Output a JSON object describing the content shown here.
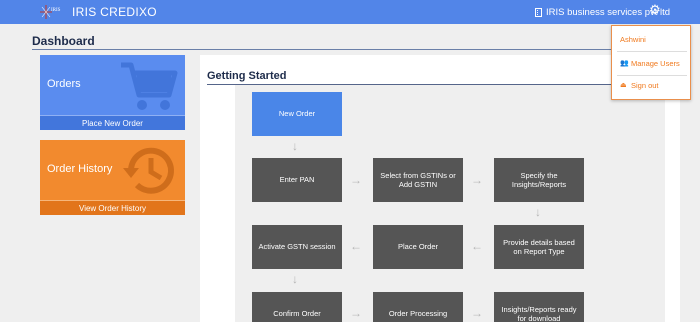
{
  "app": {
    "brand_logo_text": "IRIS",
    "brand_title": "IRIS CREDIXO",
    "company": "IRIS business services pvt ltd"
  },
  "icons": {
    "company": "building-icon",
    "settings": "gear-icon",
    "manage_users": "users-icon",
    "sign_out": "sign-out-icon",
    "orders": "cart-icon",
    "history": "history-icon"
  },
  "page": {
    "title": "Dashboard"
  },
  "tiles": {
    "orders": {
      "label": "Orders",
      "footer": "Place New Order"
    },
    "history": {
      "label": "Order History",
      "footer": "View Order History"
    }
  },
  "getting_started": {
    "title": "Getting Started",
    "steps": {
      "new_order": "New Order",
      "enter_pan": "Enter PAN",
      "select_gstin": "Select from GSTINs or Add GSTIN",
      "specify_insights": "Specify the Insights/Reports",
      "provide_details": "Provide details based on Report Type",
      "place_order": "Place Order",
      "activate_gstn": "Activate GSTN session",
      "confirm_order": "Confirm Order",
      "order_processing": "Order Processing",
      "insights_ready": "Insights/Reports ready for download"
    }
  },
  "user_menu": {
    "username": "Ashwini",
    "manage_users": "Manage Users",
    "sign_out": "Sign out"
  },
  "colors": {
    "topbar": "#5285e8",
    "orders_tile": "#5a8cef",
    "history_tile": "#f28a2e",
    "step_box": "#555555",
    "start_box": "#4a86e8",
    "menu_accent": "#f07a1f"
  }
}
